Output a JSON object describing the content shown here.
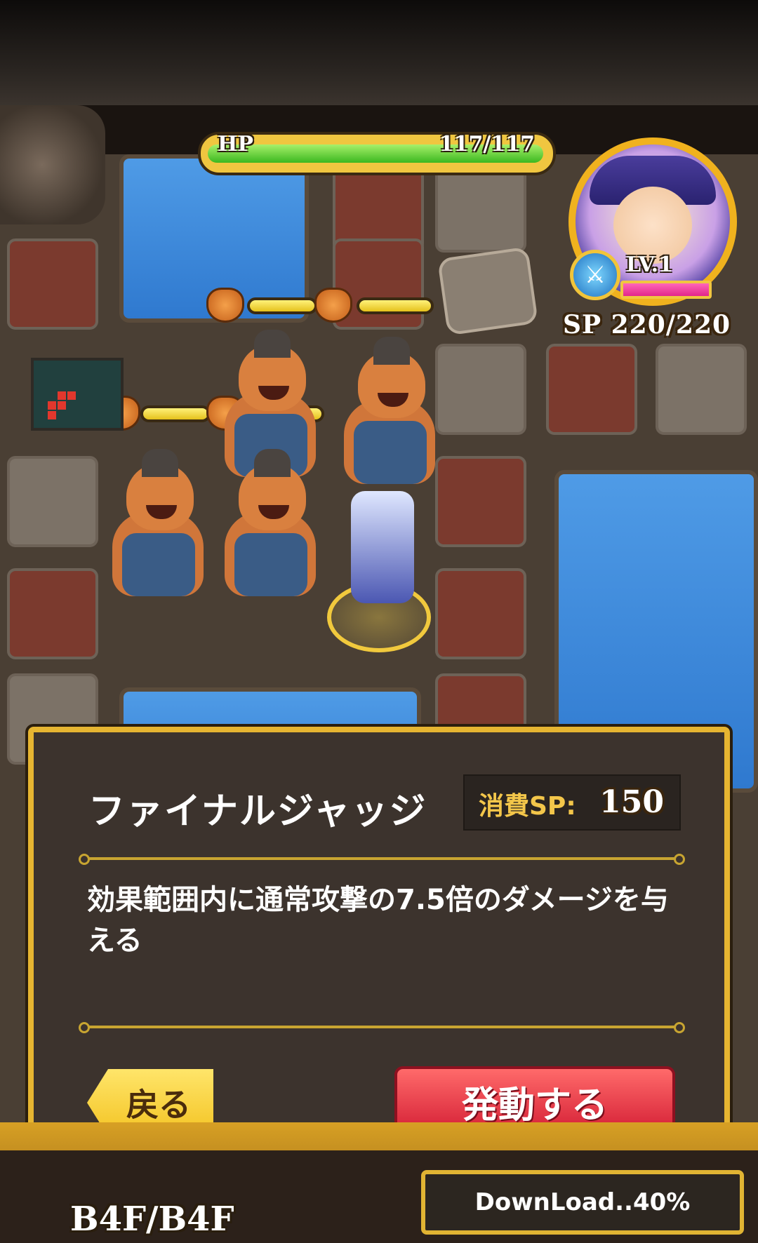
{
  "hud": {
    "hp_label": "HP",
    "hp_value": "117/117",
    "hp_fraction": 1.0,
    "level": "LV.1",
    "sp": "SP 220/220"
  },
  "dialog": {
    "skill_name": "ファイナルジャッジ",
    "cost_label": "消費SP:",
    "cost_value": "150",
    "description": "効果範囲内に通常攻撃の7.5倍のダメージを与える",
    "back_button": "戻る",
    "activate_button": "発動する"
  },
  "footer": {
    "floor": "B4F/B4F",
    "download": "DownLoad..40%"
  },
  "colors": {
    "accent_gold": "#e6b531",
    "hp_green": "#3bb820",
    "activate_red": "#d41f35"
  }
}
